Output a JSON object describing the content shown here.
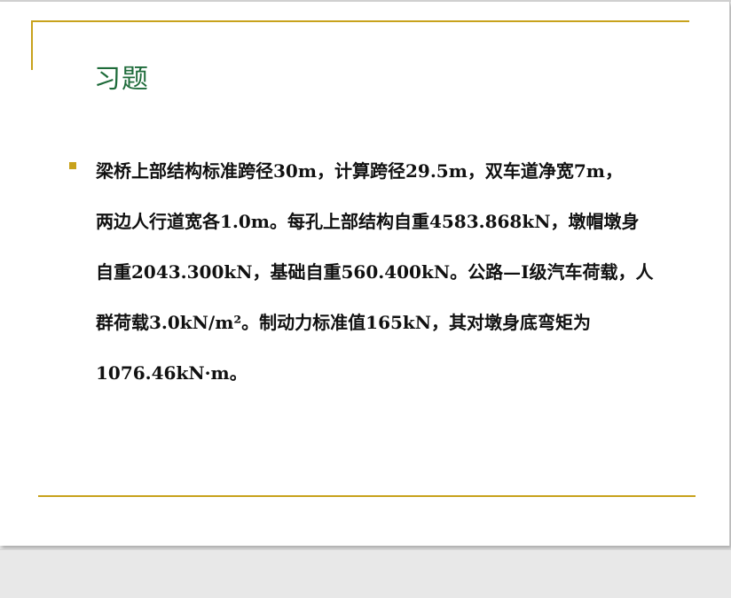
{
  "slide": {
    "title": "习题",
    "body_lines": [
      "梁桥上部结构标准跨径30m，计算跨径29.5m，双车道净宽7m，",
      "两边人行道宽各1.0m。每孔上部结构自重4583.868kN，墩帽墩身",
      "自重2043.300kN，基础自重560.400kN。公路—I级汽车荷载，人",
      "群荷载3.0kN/m²。制动力标准值165kN，其对墩身底弯矩为",
      "1076.46kN·m。"
    ]
  },
  "colors": {
    "title": "#1e6b3a",
    "accent_rule": "#c8a21c",
    "bullet": "#c8a21c",
    "body_text": "#111111",
    "slide_background": "#ffffff",
    "app_background": "#e6e6e6"
  },
  "icons": {
    "bullet": "square-bullet-icon"
  }
}
